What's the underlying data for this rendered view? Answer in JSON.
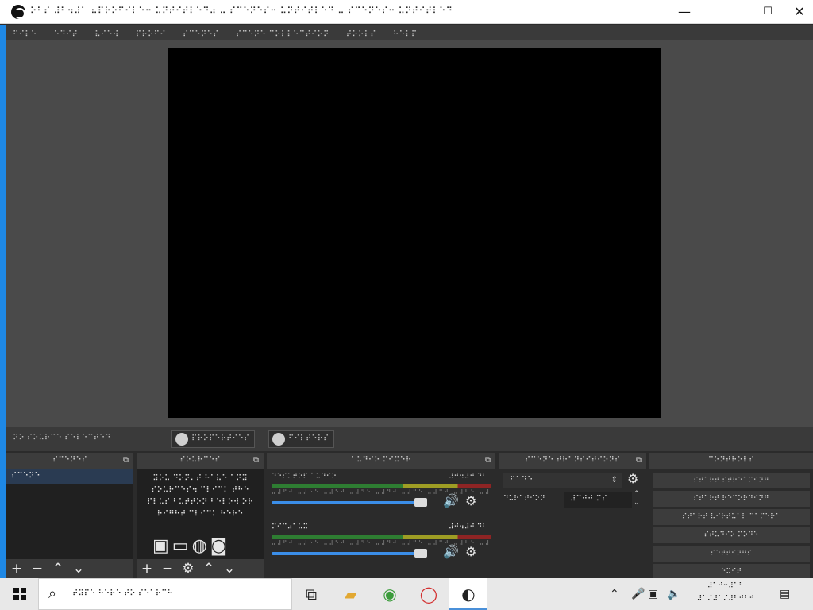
{
  "window": {
    "title": "⠕⠃⠎ ⠼⠃⠲⠼⠁ ⠦⠏⠗⠕⠋⠊⠇⠑⠒ ⠥⠝⠞⠊⠞⠇⠑⠙⠴ ⠤ ⠎⠉⠑⠝⠑⠎⠒ ⠥⠝⠞⠊⠞⠇⠑⠙ ⠤ ⠎⠉⠑⠝⠑⠎⠒ ⠥⠝⠞⠊⠞⠇⠑⠙",
    "minimize": "—",
    "maximize": "☐",
    "close": "✕"
  },
  "menu": {
    "items": [
      "⠋⠊⠇⠑",
      "⠑⠙⠊⠞",
      "⠧⠊⠑⠺",
      "⠏⠗⠕⠋⠊",
      "⠎⠉⠑⠝⠑⠎",
      "⠎⠉⠑⠝⠑ ⠉⠕⠇⠇⠑⠉⠞⠊⠕⠝",
      "⠞⠕⠕⠇⠎",
      "⠓⠑⠇⠏"
    ]
  },
  "toolbar": {
    "no_source": "⠝⠕ ⠎⠕⠥⠗⠉⠑ ⠎⠑⠇⠑⠉⠞⠑⠙",
    "properties": "⠏⠗⠕⠏⠑⠗⠞⠊⠑⠎",
    "filters": "⠋⠊⠇⠞⠑⠗⠎"
  },
  "docks": {
    "scenes": {
      "title": "⠎⠉⠑⠝⠑⠎",
      "items": [
        "⠎⠉⠑⠝⠑"
      ]
    },
    "sources": {
      "title": "⠎⠕⠥⠗⠉⠑⠎",
      "message": "⠽⠕⠥ ⠙⠕⠝⠄⠞ ⠓⠁⠧⠑ ⠁⠝⠽ ⠎⠕⠥⠗⠉⠑⠎⠲ ⠉⠇⠊⠉⠅ ⠞⠓⠑ ⠏⠇⠥⠎ ⠃⠥⠞⠞⠕⠝ ⠃⠑⠇⠕⠺ ⠕⠗ ⠗⠊⠛⠓⠞ ⠉⠇⠊⠉⠅ ⠓⠑⠗⠑"
    },
    "mixer": {
      "title": "⠁⠥⠙⠊⠕ ⠍⠊⠭⠑⠗",
      "channels": [
        {
          "name": "⠙⠑⠎⠅⠞⠕⠏ ⠁⠥⠙⠊⠕",
          "db": "⠼⠚⠲⠼⠚ ⠙⠃",
          "level": 0.93
        },
        {
          "name": "⠍⠊⠉⠴⠁⠥⠭",
          "db": "⠼⠚⠲⠼⠚ ⠙⠃",
          "level": 0.93
        }
      ],
      "ticks": "⠤⠼⠋⠚ ⠤⠼⠑⠑ ⠤⠼⠑⠚ ⠤⠼⠙⠑ ⠤⠼⠙⠚ ⠤⠼⠉⠑ ⠤⠼⠉⠚ ⠤⠼⠃⠑ ⠤⠼⠃⠚ ⠤⠼⠁⠑ ⠤⠼⠁⠚ ⠤⠼⠑ ⠼⠚"
    },
    "transitions": {
      "title": "⠎⠉⠑⠝⠑ ⠞⠗⠁⠝⠎⠊⠞⠊⠕⠝⠎",
      "type": "⠋⠁⠙⠑",
      "duration_label": "⠙⠥⠗⠁⠞⠊⠕⠝",
      "duration_value": "⠼⠉⠚⠚ ⠍⠎"
    },
    "controls": {
      "title": "⠉⠕⠝⠞⠗⠕⠇⠎",
      "buttons": [
        "⠎⠞⠁⠗⠞ ⠎⠞⠗⠑⠁⠍⠊⠝⠛",
        "⠎⠞⠁⠗⠞ ⠗⠑⠉⠕⠗⠙⠊⠝⠛",
        "⠎⠞⠁⠗⠞ ⠧⠊⠗⠞⠥⠁⠇ ⠉⠁⠍⠑⠗⠁",
        "⠎⠞⠥⠙⠊⠕ ⠍⠕⠙⠑",
        "⠎⠑⠞⠞⠊⠝⠛⠎",
        "⠑⠭⠊⠞"
      ]
    }
  },
  "taskbar": {
    "search_placeholder": "⠞⠽⠏⠑ ⠓⠑⠗⠑ ⠞⠕ ⠎⠑⠁⠗⠉⠓",
    "clock_time": "⠼⠁⠚⠒⠼⠁⠃",
    "clock_date": "⠼⠁⠌⠼⠁⠌⠼⠃⠚⠃⠚"
  }
}
